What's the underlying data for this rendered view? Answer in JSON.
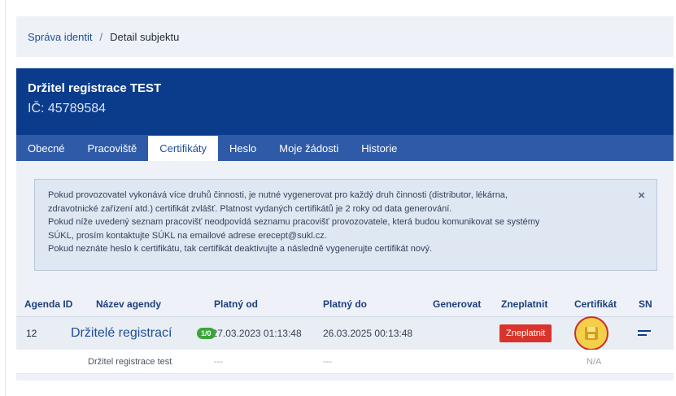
{
  "breadcrumb": {
    "parent": "Správa identit",
    "separator": "/",
    "current": "Detail subjektu"
  },
  "header": {
    "title": "Držitel registrace TEST",
    "ic": "IČ: 45789584"
  },
  "tabs": [
    {
      "label": "Obecné",
      "active": false
    },
    {
      "label": "Pracoviště",
      "active": false
    },
    {
      "label": "Certifikáty",
      "active": true
    },
    {
      "label": "Heslo",
      "active": false
    },
    {
      "label": "Moje žádosti",
      "active": false
    },
    {
      "label": "Historie",
      "active": false
    }
  ],
  "alert": {
    "lines": [
      "Pokud provozovatel vykonává více druhů činnosti, je nutné vygenerovat pro každý druh činnosti (distributor, lékárna,",
      "zdravotnické zařízení atd.) certifikát zvlášť. Platnost vydaných certifikátů je 2 roky od data generování.",
      "Pokud níže uvedený seznam pracovišť neodpovídá seznamu pracovišť provozovatele, která budou komunikovat se systémy",
      "SÚKL, prosím kontaktujte SÚKL na emailové adrese erecept@sukl.cz.",
      "Pokud neznáte heslo k certifikátu, tak certifikát deaktivujte a následně vygenerujte certifikát nový."
    ],
    "close_icon": "×"
  },
  "table": {
    "headers": {
      "agenda_id": "Agenda ID",
      "agenda_name": "Název agendy",
      "valid_from": "Platný od",
      "valid_to": "Platný do",
      "generate": "Generovat",
      "invalidate": "Zneplatnit",
      "certificate": "Certifikát",
      "sn": "SN"
    },
    "row": {
      "agenda_id": "12",
      "agenda_name": "Držitelé registrací",
      "badge": "1/0",
      "valid_from": "27.03.2023 01:13:48",
      "valid_to": "26.03.2025 00:13:48",
      "invalidate_label": "Zneplatnit",
      "certificate_icon": "save-icon",
      "sn_icon": "menu-lines-icon"
    },
    "subrow": {
      "name": "Držitel registrace test",
      "valid_from": "---",
      "valid_to": "---",
      "certificate": "N/A"
    }
  },
  "colors": {
    "header_bg": "#0b3c8c",
    "tabs_bg": "#2f5aa8",
    "danger": "#d9342b",
    "highlight": "#f4cf49",
    "badge": "#3aa53a"
  }
}
